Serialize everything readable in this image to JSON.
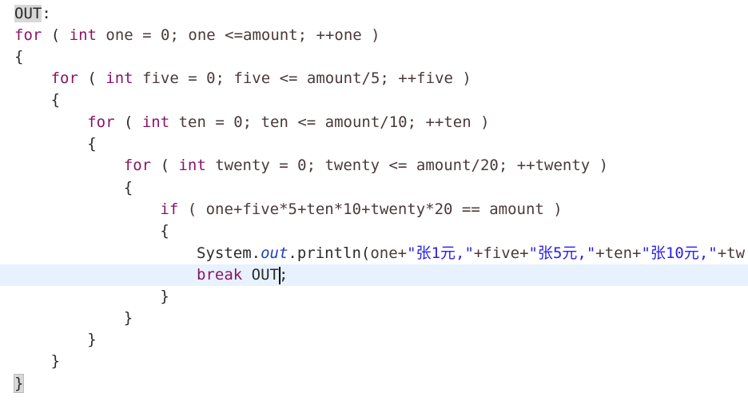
{
  "editor": {
    "current_line_index": 12,
    "caret_after": "OUT",
    "lines": [
      {
        "indent": 0,
        "tokens": [
          {
            "t": "OUT",
            "c": "plain label-hl"
          },
          {
            "t": ":",
            "c": "plain"
          }
        ]
      },
      {
        "indent": 0,
        "tokens": [
          {
            "t": "for",
            "c": "kw"
          },
          {
            "t": " ( ",
            "c": "plain"
          },
          {
            "t": "int",
            "c": "kw"
          },
          {
            "t": " one = 0; one <=amount; ++one )",
            "c": "var"
          }
        ]
      },
      {
        "indent": 0,
        "tokens": [
          {
            "t": "{",
            "c": "plain"
          }
        ]
      },
      {
        "indent": 1,
        "tokens": [
          {
            "t": "for",
            "c": "kw"
          },
          {
            "t": " ( ",
            "c": "plain"
          },
          {
            "t": "int",
            "c": "kw"
          },
          {
            "t": " five = 0; five <= amount/5; ++five )",
            "c": "var"
          }
        ]
      },
      {
        "indent": 1,
        "tokens": [
          {
            "t": "{",
            "c": "plain"
          }
        ]
      },
      {
        "indent": 2,
        "tokens": [
          {
            "t": "for",
            "c": "kw"
          },
          {
            "t": " ( ",
            "c": "plain"
          },
          {
            "t": "int",
            "c": "kw"
          },
          {
            "t": " ten = 0; ten <= amount/10; ++ten )",
            "c": "var"
          }
        ]
      },
      {
        "indent": 2,
        "tokens": [
          {
            "t": "{",
            "c": "plain"
          }
        ]
      },
      {
        "indent": 3,
        "tokens": [
          {
            "t": "for",
            "c": "kw"
          },
          {
            "t": " ( ",
            "c": "plain"
          },
          {
            "t": "int",
            "c": "kw"
          },
          {
            "t": " twenty = 0; twenty <= amount/20; ++twenty )",
            "c": "var"
          }
        ]
      },
      {
        "indent": 3,
        "tokens": [
          {
            "t": "{",
            "c": "plain"
          }
        ]
      },
      {
        "indent": 4,
        "tokens": [
          {
            "t": "if",
            "c": "kw"
          },
          {
            "t": " ( one+five*5+ten*10+twenty*20 == amount )",
            "c": "var"
          }
        ]
      },
      {
        "indent": 4,
        "tokens": [
          {
            "t": "{",
            "c": "plain"
          }
        ]
      },
      {
        "indent": 5,
        "tokens": [
          {
            "t": "System.",
            "c": "plain"
          },
          {
            "t": "out",
            "c": "field"
          },
          {
            "t": ".println(",
            "c": "plain"
          },
          {
            "t": "one+",
            "c": "var"
          },
          {
            "t": "\"张1元,\"",
            "c": "str"
          },
          {
            "t": "+five+",
            "c": "var"
          },
          {
            "t": "\"张5元,\"",
            "c": "str"
          },
          {
            "t": "+ten+",
            "c": "var"
          },
          {
            "t": "\"张10元,\"",
            "c": "str"
          },
          {
            "t": "+tw",
            "c": "var"
          }
        ]
      },
      {
        "indent": 5,
        "tokens": [
          {
            "t": "break",
            "c": "kw"
          },
          {
            "t": " OUT",
            "c": "plain"
          },
          {
            "t": "|caret|",
            "c": "caret"
          },
          {
            "t": ";",
            "c": "plain"
          }
        ]
      },
      {
        "indent": 4,
        "tokens": [
          {
            "t": "}",
            "c": "plain"
          }
        ]
      },
      {
        "indent": 3,
        "tokens": [
          {
            "t": "}",
            "c": "plain"
          }
        ]
      },
      {
        "indent": 2,
        "tokens": [
          {
            "t": "}",
            "c": "plain"
          }
        ]
      },
      {
        "indent": 1,
        "tokens": [
          {
            "t": "}",
            "c": "plain"
          }
        ]
      },
      {
        "indent": 0,
        "tokens": [
          {
            "t": "}",
            "c": "plain brace-hl"
          }
        ]
      }
    ]
  }
}
